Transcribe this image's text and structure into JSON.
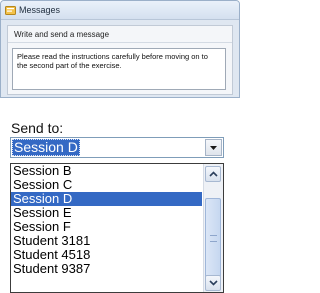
{
  "window": {
    "title": "Messages",
    "icon": "messages-app-icon",
    "group_label": "Write and send a message",
    "message_lines": [
      "Please read the instructions carefully before moving on to",
      "the second part of the exercise."
    ]
  },
  "send_to": {
    "label": "Send to:",
    "selected_value": "Session D",
    "options": [
      "Session B",
      "Session C",
      "Session D",
      "Session E",
      "Session F",
      "Student 3181",
      "Student 4518",
      "Student 9387"
    ],
    "selected_index": 2,
    "scroll_position": 0.4
  },
  "colors": {
    "selection": "#3469c4",
    "window_bg": "#dfe7f1"
  }
}
